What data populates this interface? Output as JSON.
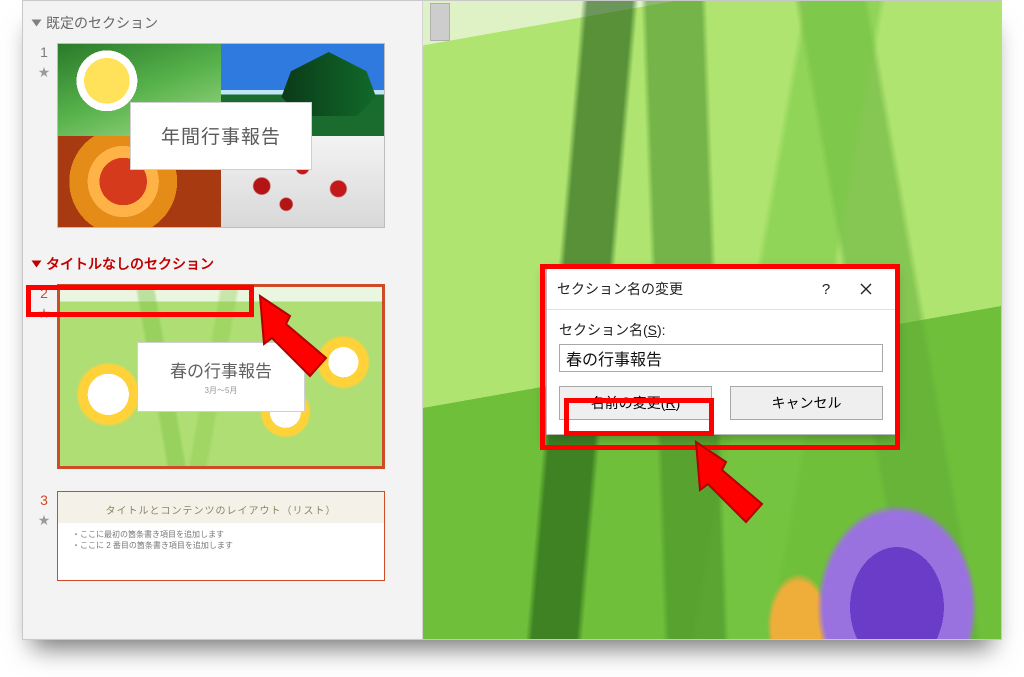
{
  "sections": {
    "default": {
      "label": "既定のセクション"
    },
    "untitled": {
      "label": "タイトルなしのセクション"
    }
  },
  "slides": {
    "s1": {
      "num": "1",
      "title": "年間行事報告"
    },
    "s2": {
      "num": "2",
      "title": "春の行事報告",
      "sub": "3月～5月"
    },
    "s3": {
      "num": "3",
      "heading": "タイトルとコンテンツのレイアウト（リスト）",
      "b1": "ここに最初の箇条書き項目を追加します",
      "b2": "ここに 2 番目の箇条書き項目を追加します"
    }
  },
  "dialog": {
    "title": "セクション名の変更",
    "help": "?",
    "close": "✕",
    "label_before": "セクション名(",
    "label_u": "S",
    "label_after": "):",
    "input_value": "春の行事報告",
    "rename_before": "名前の変更(",
    "rename_u": "R",
    "rename_after": ")",
    "cancel": "キャンセル"
  }
}
